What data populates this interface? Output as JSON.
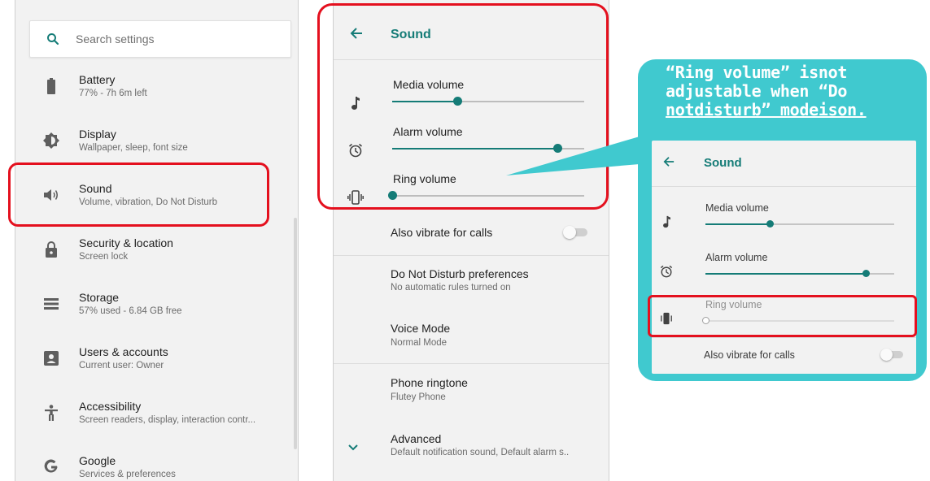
{
  "settings": {
    "search_placeholder": "Search settings",
    "items": [
      {
        "title": "Battery",
        "summary": "77% - 7h 6m left",
        "icon": "battery-icon"
      },
      {
        "title": "Display",
        "summary": "Wallpaper, sleep, font size",
        "icon": "brightness-icon"
      },
      {
        "title": "Sound",
        "summary": "Volume, vibration, Do Not Disturb",
        "icon": "volume-icon"
      },
      {
        "title": "Security & location",
        "summary": "Screen lock",
        "icon": "lock-icon"
      },
      {
        "title": "Storage",
        "summary": "57% used - 6.84 GB free",
        "icon": "storage-icon"
      },
      {
        "title": "Users & accounts",
        "summary": "Current user: Owner",
        "icon": "account-box-icon"
      },
      {
        "title": "Accessibility",
        "summary": "Screen readers, display, interaction contr...",
        "icon": "accessibility-icon"
      },
      {
        "title": "Google",
        "summary": "Services & preferences",
        "icon": "google-icon"
      }
    ]
  },
  "sound": {
    "title": "Sound",
    "volumes": [
      {
        "label": "Media volume",
        "level": 0.34,
        "icon": "music-note-icon"
      },
      {
        "label": "Alarm volume",
        "level": 0.86,
        "icon": "alarm-clock-icon"
      },
      {
        "label": "Ring volume",
        "level": 0.0,
        "icon": "vibrate-icon"
      }
    ],
    "vibrate_label": "Also vibrate for calls",
    "vibrate_on": false,
    "items": [
      {
        "title": "Do Not Disturb preferences",
        "summary": "No automatic rules turned on"
      },
      {
        "title": "Voice Mode",
        "summary": "Normal Mode"
      },
      {
        "title": "Phone ringtone",
        "summary": "Flutey Phone"
      },
      {
        "title": "Advanced",
        "summary": "Default notification sound, Default alarm s.."
      }
    ]
  },
  "callout": {
    "line1": "“Ring volume” isnot",
    "line2": "adjustable when “Do",
    "line3": "notdisturb” modeison.",
    "inset": {
      "title": "Sound",
      "media_label": "Media volume",
      "media_level": 0.34,
      "alarm_label": "Alarm volume",
      "alarm_level": 0.85,
      "ring_label": "Ring volume",
      "ring_level": 0.0,
      "vibrate_label": "Also vibrate for calls"
    }
  },
  "colors": {
    "accent": "#157c77",
    "highlight": "#e4101e",
    "callout": "#40c9cf"
  }
}
